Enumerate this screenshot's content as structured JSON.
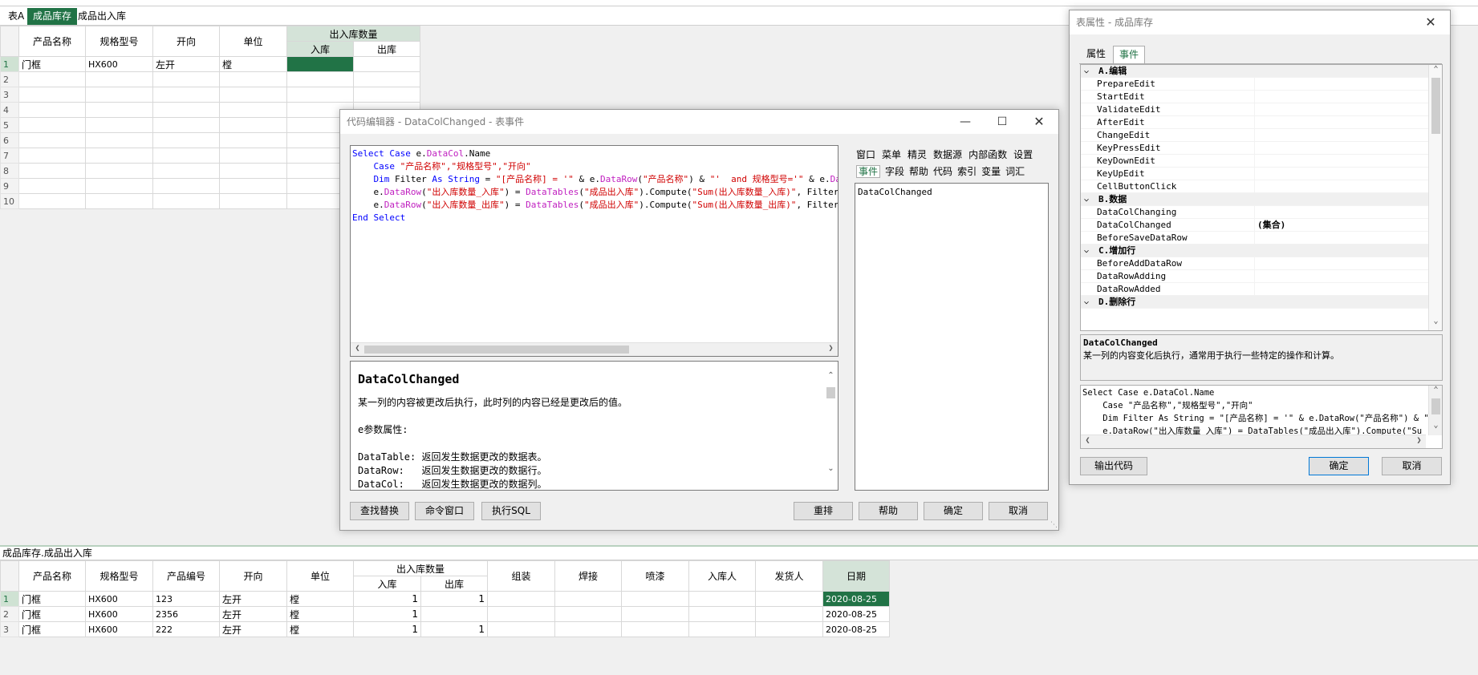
{
  "tabs": {
    "label": "表A",
    "items": [
      "成品库存",
      "成品出入库"
    ]
  },
  "top_grid": {
    "group_header": "出入库数量",
    "columns": [
      "产品名称",
      "规格型号",
      "开向",
      "单位"
    ],
    "sub_columns": [
      "入库",
      "出库"
    ],
    "row_numbers": [
      "1",
      "2",
      "3",
      "4",
      "5",
      "6",
      "7",
      "8",
      "9",
      "10"
    ],
    "rows": [
      [
        "门框",
        "HX600",
        "左开",
        "樘",
        "",
        ""
      ]
    ]
  },
  "bottom_path": "成品库存.成品出入库",
  "bottom_grid": {
    "group_header": "出入库数量",
    "columns_before": [
      "产品名称",
      "规格型号",
      "产品编号",
      "开向",
      "单位"
    ],
    "sub_columns": [
      "入库",
      "出库"
    ],
    "columns_after": [
      "组装",
      "焊接",
      "喷漆",
      "入库人",
      "发货人",
      "日期"
    ],
    "row_numbers": [
      "1",
      "2",
      "3"
    ],
    "rows": [
      [
        "门框",
        "HX600",
        "123",
        "左开",
        "樘",
        "1",
        "1",
        "",
        "",
        "",
        "",
        "",
        "2020-08-25"
      ],
      [
        "门框",
        "HX600",
        "2356",
        "左开",
        "樘",
        "1",
        "",
        "",
        "",
        "",
        "",
        "",
        "2020-08-25"
      ],
      [
        "门框",
        "HX600",
        "222",
        "左开",
        "樘",
        "1",
        "1",
        "",
        "",
        "",
        "",
        "",
        "2020-08-25"
      ]
    ]
  },
  "code_editor": {
    "title": "代码编辑器 - DataColChanged - 表事件",
    "doc_title": "DataColChanged",
    "doc_lines": [
      "某一列的内容被更改后执行，此时列的内容已经是更改后的值。",
      "e参数属性:",
      "DataTable: 返回发生数据更改的数据表。",
      "DataRow:   返回发生数据更改的数据行。",
      "DataCol:   返回发生数据更改的数据列。"
    ],
    "tabs_row1": [
      "窗口",
      "菜单",
      "精灵",
      "数据源",
      "内部函数",
      "设置"
    ],
    "tabs_row2": [
      "事件",
      "字段",
      "帮助",
      "代码",
      "索引",
      "变量",
      "词汇"
    ],
    "event_list": [
      "DataColChanged"
    ],
    "buttons_left": [
      "查找替换",
      "命令窗口",
      "执行SQL"
    ],
    "buttons_right": [
      "重排",
      "帮助",
      "确定",
      "取消"
    ]
  },
  "props": {
    "title": "表属性 - 成品库存",
    "tabs": [
      "属性",
      "事件"
    ],
    "rows": [
      {
        "cat": true,
        "name": "A.编辑"
      },
      {
        "name": "PrepareEdit",
        "value": ""
      },
      {
        "name": "StartEdit",
        "value": ""
      },
      {
        "name": "ValidateEdit",
        "value": ""
      },
      {
        "name": "AfterEdit",
        "value": ""
      },
      {
        "name": "ChangeEdit",
        "value": ""
      },
      {
        "name": "KeyPressEdit",
        "value": ""
      },
      {
        "name": "KeyDownEdit",
        "value": ""
      },
      {
        "name": "KeyUpEdit",
        "value": ""
      },
      {
        "name": "CellButtonClick",
        "value": ""
      },
      {
        "cat": true,
        "name": "B.数据"
      },
      {
        "name": "DataColChanging",
        "value": ""
      },
      {
        "name": "DataColChanged",
        "value": "(集合)"
      },
      {
        "name": "BeforeSaveDataRow",
        "value": ""
      },
      {
        "cat": true,
        "name": "C.增加行"
      },
      {
        "name": "BeforeAddDataRow",
        "value": ""
      },
      {
        "name": "DataRowAdding",
        "value": ""
      },
      {
        "name": "DataRowAdded",
        "value": ""
      },
      {
        "cat": true,
        "name": "D.删除行"
      }
    ],
    "desc_title": "DataColChanged",
    "desc_text": "某一列的内容变化后执行，通常用于执行一些特定的操作和计算。",
    "preview_lines": [
      "Select Case e.DataCol.Name",
      "    Case \"产品名称\",\"规格型号\",\"开向\"",
      "    Dim Filter As String = \"[产品名称] = '\" & e.DataRow(\"产品名称\") & \"",
      "    e.DataRow(\"出入库数量_入库\") = DataTables(\"成品出入库\").Compute(\"Su"
    ],
    "buttons": [
      "输出代码",
      "确定",
      "取消"
    ]
  }
}
